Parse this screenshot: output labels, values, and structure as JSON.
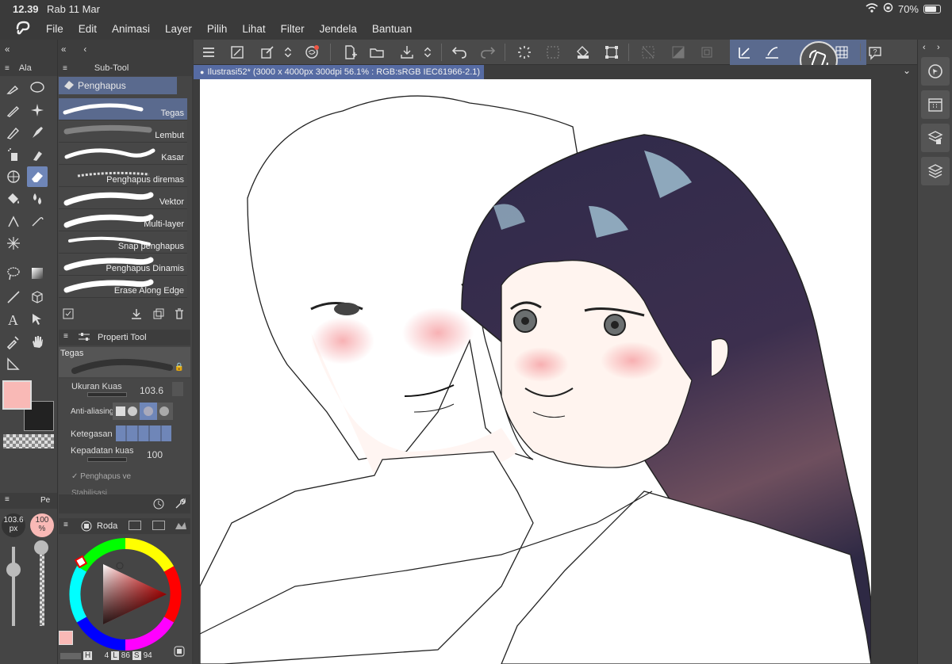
{
  "status": {
    "time": "12.39",
    "date": "Rab 11 Mar",
    "battery": "70%"
  },
  "menu": [
    "File",
    "Edit",
    "Animasi",
    "Layer",
    "Pilih",
    "Lihat",
    "Filter",
    "Jendela",
    "Bantuan"
  ],
  "panels": {
    "tool_tab": "Ala",
    "subtool_tab": "Sub-Tool",
    "subtool_group": "Penghapus",
    "property_tab": "Properti Tool",
    "color_tab": "Roda",
    "bottom_left_tab": "Pe"
  },
  "document": {
    "tab_title": "Ilustrasi52* (3000 x 4000px 300dpi 56.1% : RGB:sRGB IEC61966-2.1)"
  },
  "brushes": [
    {
      "label": "Tegas"
    },
    {
      "label": "Lembut"
    },
    {
      "label": "Kasar"
    },
    {
      "label": "Penghapus diremas"
    },
    {
      "label": "Vektor"
    },
    {
      "label": "Multi-layer"
    },
    {
      "label": "Snap penghapus"
    },
    {
      "label": "Penghapus Dinamis"
    },
    {
      "label": "Erase Along Edge"
    }
  ],
  "properties": {
    "preview_name": "Tegas",
    "brush_size_label": "Ukuran Kuas",
    "brush_size_value": "103.6",
    "antialias_label": "Anti-aliasing",
    "hardness_label": "Ketegasan",
    "density_label": "Kepadatan kuas",
    "density_value": "100",
    "erase_vector_label": "Penghapus ve",
    "stabilize_label": "Stabilisasi"
  },
  "left_bottom": {
    "size_value": "103.6",
    "size_unit": "px",
    "opacity_value": "100",
    "opacity_unit": "%"
  },
  "color": {
    "main": "#f9b9b6",
    "sub": "#222222",
    "h_label": "H",
    "h_value": "4",
    "l_label": "L",
    "l_value": "86",
    "s_label": "S",
    "s_value": "94"
  },
  "accent": {
    "selection": "#5a6a8e",
    "tool_active": "#6f86b8"
  }
}
